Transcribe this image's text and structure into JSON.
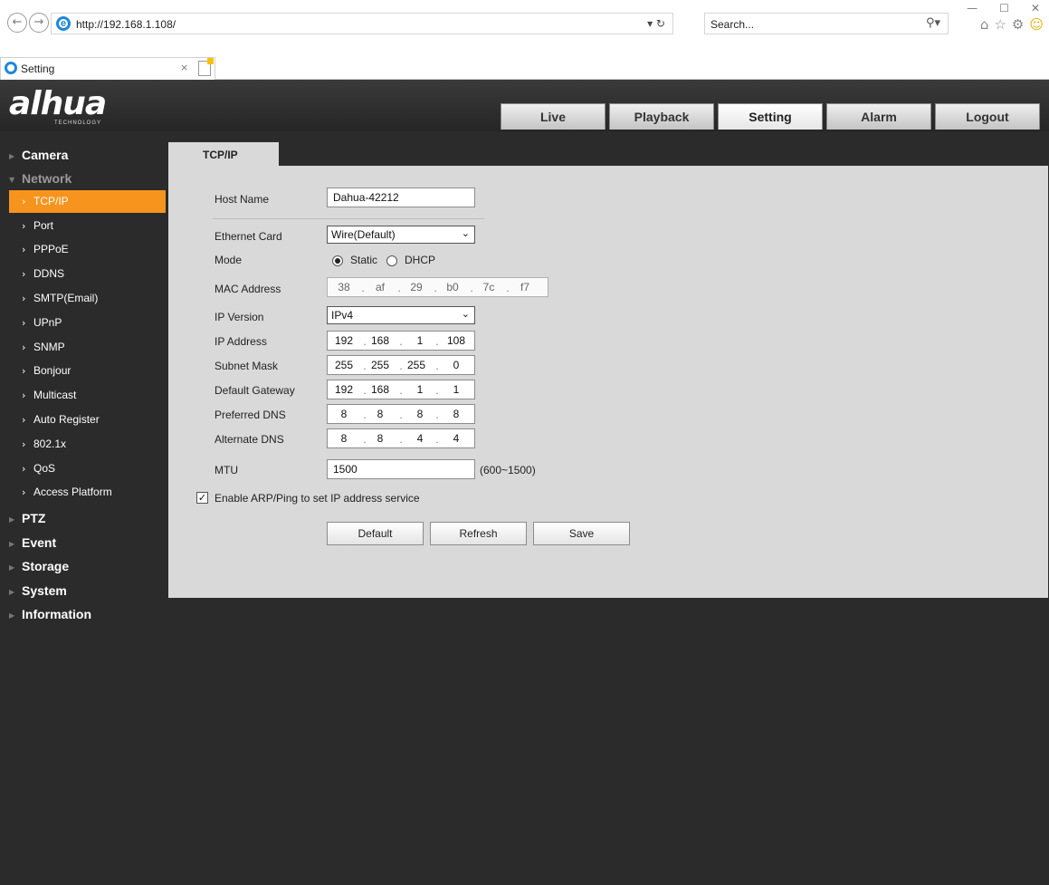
{
  "browser": {
    "url": "http://192.168.1.108/",
    "search_placeholder": "Search...",
    "tab_title": "Setting",
    "tab_close": "×",
    "addr_controls": "▾ ↻"
  },
  "app": {
    "logo": "alhua",
    "logo_sub": "TECHNOLOGY",
    "main_tabs": [
      "Live",
      "Playback",
      "Setting",
      "Alarm",
      "Logout"
    ],
    "active_tab": "Setting"
  },
  "sidebar": {
    "camera": "Camera",
    "network": "Network",
    "network_items": [
      "TCP/IP",
      "Port",
      "PPPoE",
      "DDNS",
      "SMTP(Email)",
      "UPnP",
      "SNMP",
      "Bonjour",
      "Multicast",
      "Auto Register",
      "802.1x",
      "QoS",
      "Access Platform"
    ],
    "ptz": "PTZ",
    "event": "Event",
    "storage": "Storage",
    "system": "System",
    "information": "Information",
    "active_item": "TCP/IP"
  },
  "content": {
    "tab_title": "TCP/IP",
    "host_name_label": "Host Name",
    "host_name_value": "Dahua-42212",
    "ethernet_card_label": "Ethernet Card",
    "ethernet_card_value": "Wire(Default)",
    "mode_label": "Mode",
    "mode_static": "Static",
    "mode_dhcp": "DHCP",
    "mode_selected": "Static",
    "mac_label": "MAC Address",
    "mac": [
      "38",
      "af",
      "29",
      "b0",
      "7c",
      "f7"
    ],
    "ip_version_label": "IP Version",
    "ip_version_value": "IPv4",
    "ip_address_label": "IP Address",
    "ip_address": [
      "192",
      "168",
      "1",
      "108"
    ],
    "subnet_label": "Subnet Mask",
    "subnet": [
      "255",
      "255",
      "255",
      "0"
    ],
    "gateway_label": "Default Gateway",
    "gateway": [
      "192",
      "168",
      "1",
      "1"
    ],
    "pdns_label": "Preferred DNS",
    "pdns": [
      "8",
      "8",
      "8",
      "8"
    ],
    "adns_label": "Alternate DNS",
    "adns": [
      "8",
      "8",
      "4",
      "4"
    ],
    "mtu_label": "MTU",
    "mtu_value": "1500",
    "mtu_range": "(600~1500)",
    "arp_label": "Enable ARP/Ping to set IP address service",
    "arp_checked": true,
    "buttons": {
      "default": "Default",
      "refresh": "Refresh",
      "save": "Save"
    }
  }
}
